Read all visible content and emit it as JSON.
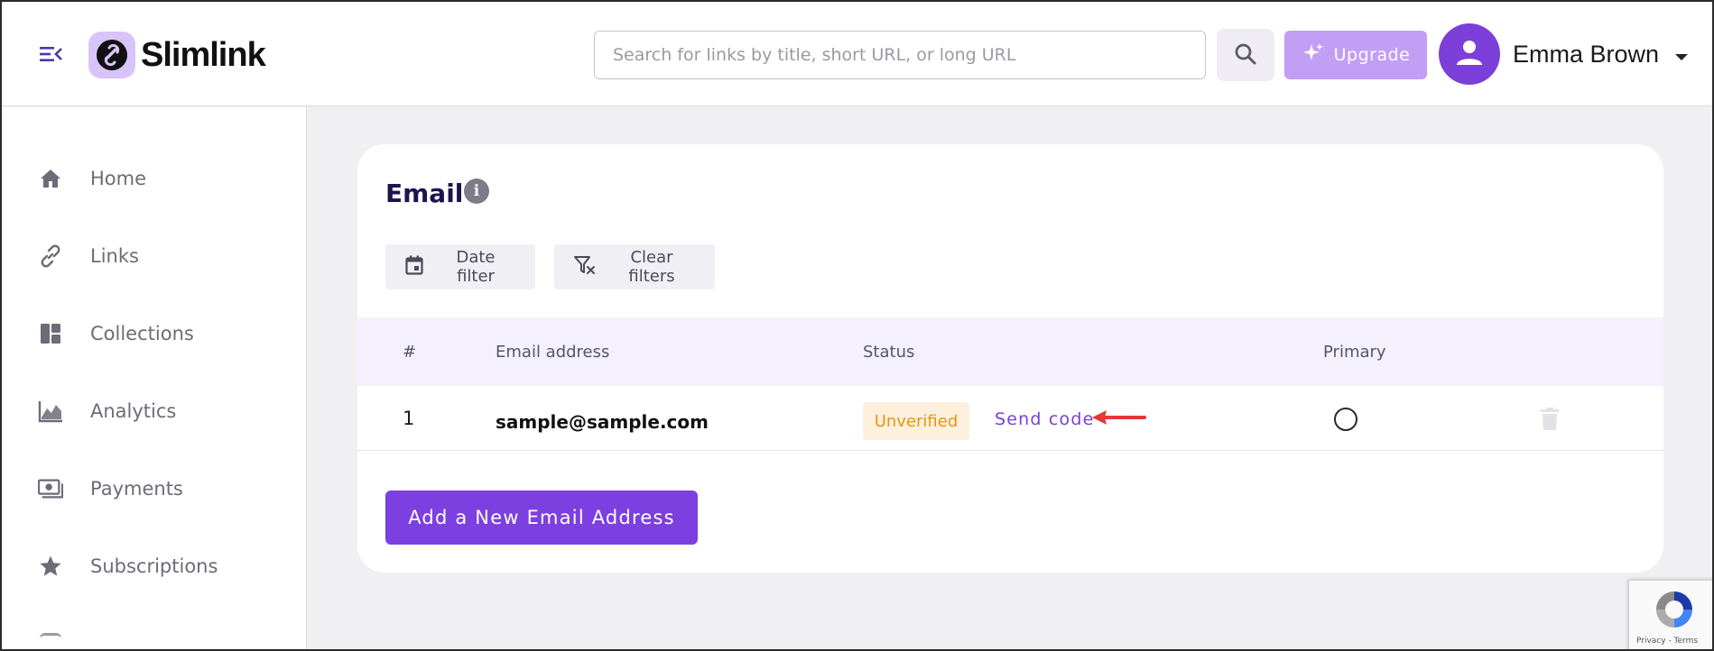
{
  "header": {
    "logo_text": "Slimlink",
    "search_placeholder": "Search for links by title, short URL, or long URL",
    "upgrade_label": "Upgrade",
    "user_name": "Emma Brown"
  },
  "sidebar": {
    "items": [
      {
        "label": "Home",
        "icon": "home-icon"
      },
      {
        "label": "Links",
        "icon": "link-icon"
      },
      {
        "label": "Collections",
        "icon": "collections-icon"
      },
      {
        "label": "Analytics",
        "icon": "analytics-icon"
      },
      {
        "label": "Payments",
        "icon": "payments-icon"
      },
      {
        "label": "Subscriptions",
        "icon": "star-icon"
      }
    ]
  },
  "main": {
    "title": "Email",
    "filters": {
      "date_filter": "Date filter",
      "clear_filters": "Clear filters"
    },
    "table": {
      "columns": [
        "#",
        "Email address",
        "Status",
        "Primary"
      ],
      "rows": [
        {
          "index": "1",
          "email": "sample@sample.com",
          "status": "Unverified",
          "action": "Send code"
        }
      ]
    },
    "add_button": "Add a New Email Address"
  },
  "recaptcha": {
    "terms": "Privacy - Terms"
  },
  "colors": {
    "accent": "#7c3fe0",
    "upgrade": "#c29ef5",
    "status_unverified_bg": "#fdf1de",
    "status_unverified_text": "#e8960c",
    "annotation_arrow": "#e53935"
  }
}
